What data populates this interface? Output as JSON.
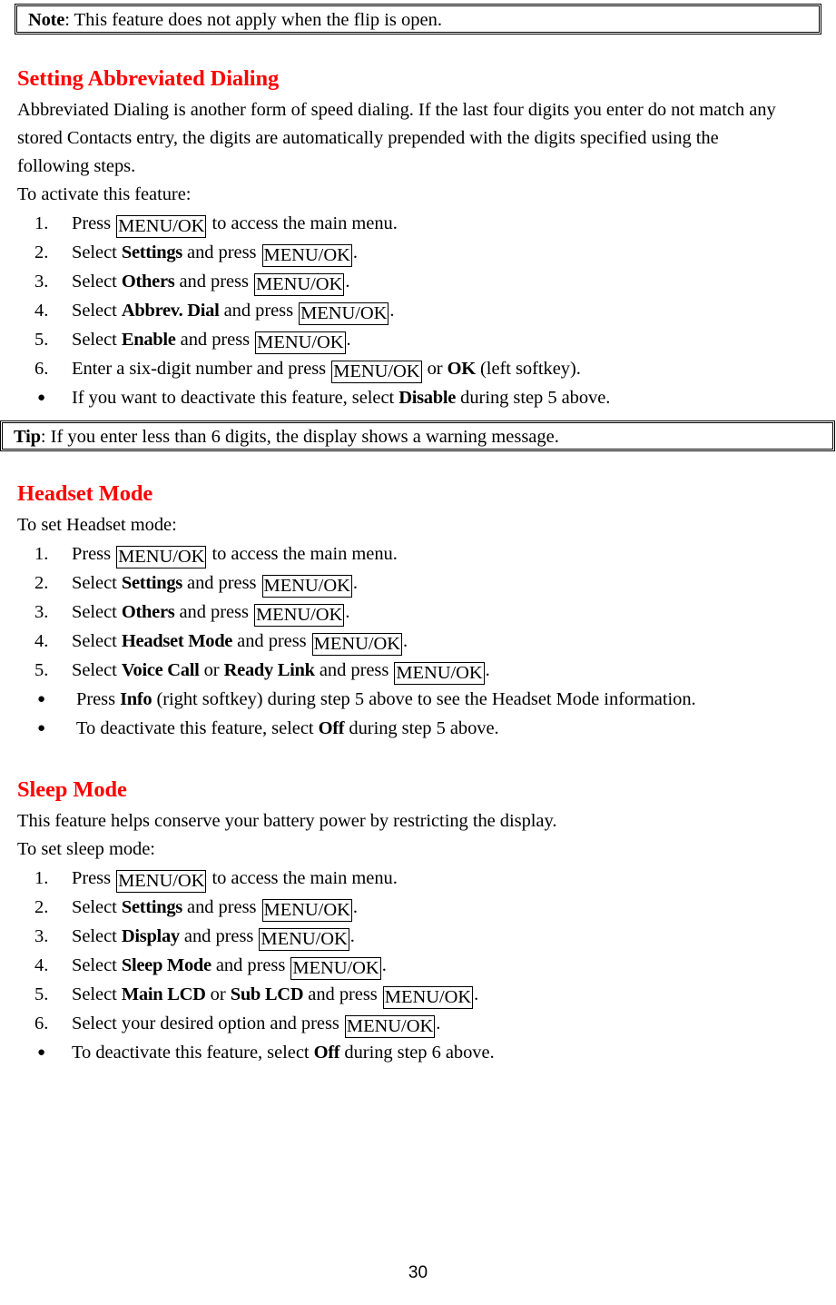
{
  "document": {
    "page_number": "30",
    "heading_color": "#ff0000",
    "text_color": "#000000"
  },
  "note_box": {
    "lead": "Note",
    "separator": ":",
    "text": " This feature does not apply when the flip is open."
  },
  "tip_box": {
    "lead": "Tip",
    "separator": ":",
    "text": " If you enter less than 6 digits, the display shows a warning message."
  },
  "sections": [
    {
      "id": "abbreviated-dialing",
      "title": "Setting Abbreviated Dialing",
      "paragraph": "Abbreviated Dialing is another form of speed dialing. If the last four digits you enter do not match any stored Contacts entry, the digits are automatically prepended with the digits specified using the following steps.",
      "intro": "To activate this feature:",
      "steps": [
        {
          "marker": "1.",
          "pre": "Press ",
          "keycap": "MENU/OK",
          "post": " to access the main menu."
        },
        {
          "marker": "2.",
          "pre": "Select ",
          "bold": "Settings",
          "mid": " and press ",
          "keycap": "MENU/OK",
          "post": "."
        },
        {
          "marker": "3.",
          "pre": "Select ",
          "bold": "Others",
          "mid": " and press ",
          "keycap": "MENU/OK",
          "post": "."
        },
        {
          "marker": "4.",
          "pre": "Select ",
          "bold": "Abbrev. Dial",
          "mid": " and press ",
          "keycap": "MENU/OK",
          "post": "."
        },
        {
          "marker": "5.",
          "pre": "Select ",
          "bold": "Enable",
          "mid": " and press ",
          "keycap": "MENU/OK",
          "post": "."
        },
        {
          "marker": "6.",
          "pre": "Enter a six-digit number and press ",
          "keycap": "MENU/OK",
          "mid2": " or ",
          "bold2": "OK",
          "post": " (left softkey)."
        }
      ],
      "bullets": [
        {
          "pre": "If you want to deactivate this feature, select ",
          "bold": "Disable",
          "post": " during step 5 above."
        }
      ]
    },
    {
      "id": "headset-mode",
      "title": "Headset Mode",
      "intro": "To set Headset mode:",
      "steps": [
        {
          "marker": "1.",
          "pre": "Press ",
          "keycap": "MENU/OK",
          "post": " to access the main menu."
        },
        {
          "marker": "2.",
          "pre": "Select ",
          "bold": "Settings",
          "mid": " and press ",
          "keycap": "MENU/OK",
          "post": "."
        },
        {
          "marker": "3.",
          "pre": "Select ",
          "bold": "Others",
          "mid": " and press ",
          "keycap": "MENU/OK",
          "post": "."
        },
        {
          "marker": "4.",
          "pre": "Select ",
          "bold": "Headset Mode",
          "mid": " and press ",
          "keycap": "MENU/OK",
          "post": "."
        },
        {
          "marker": "5.",
          "pre": "Select ",
          "bold": "Voice Call",
          "mid": " or ",
          "bold2": "Ready Link",
          "mid2": " and press ",
          "keycap": "MENU/OK",
          "post": "."
        }
      ],
      "bullets": [
        {
          "pre": " Press ",
          "bold": "Info",
          "post": " (right softkey) during step 5 above to see the Headset Mode information."
        },
        {
          "pre": " To deactivate this feature, select ",
          "bold": "Off",
          "post": " during step 5 above."
        }
      ]
    },
    {
      "id": "sleep-mode",
      "title": "Sleep Mode",
      "paragraph": "This feature helps conserve your battery power by restricting the display.",
      "intro": "To set sleep mode:",
      "steps": [
        {
          "marker": "1.",
          "pre": "Press ",
          "keycap": "MENU/OK",
          "post": " to access the main menu."
        },
        {
          "marker": "2.",
          "pre": "Select ",
          "bold": "Settings",
          "mid": " and press ",
          "keycap": "MENU/OK",
          "post": "."
        },
        {
          "marker": "3.",
          "pre": "Select ",
          "bold": "Display",
          "mid": " and press ",
          "keycap": "MENU/OK",
          "post": "."
        },
        {
          "marker": "4.",
          "pre": "Select ",
          "bold": "Sleep Mode",
          "mid": " and press ",
          "keycap": "MENU/OK",
          "post": "."
        },
        {
          "marker": "5.",
          "pre": "Select ",
          "bold": "Main LCD",
          "mid": " or ",
          "bold2": "Sub LCD",
          "mid2": " and press ",
          "keycap": "MENU/OK",
          "post": "."
        },
        {
          "marker": "6.",
          "pre": "Select your desired option and press ",
          "keycap": "MENU/OK",
          "post": "."
        }
      ],
      "bullets": [
        {
          "pre": "To deactivate this feature, select ",
          "bold": "Off",
          "post": " during step 6 above."
        }
      ]
    }
  ],
  "bullet_glyph": "●"
}
